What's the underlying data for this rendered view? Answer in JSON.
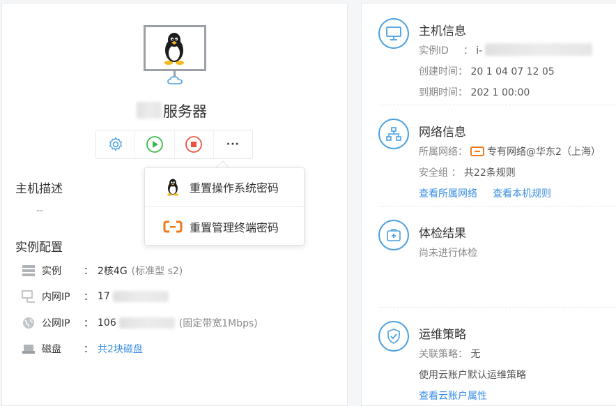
{
  "left": {
    "server_title": "服务器",
    "actions": {
      "more": "···"
    },
    "menu": {
      "reset_os_password": "重置操作系统密码",
      "reset_terminal_password": "重置管理终端密码"
    },
    "host_desc": {
      "title": "主机描述",
      "value": "--"
    },
    "instance_config": {
      "title": "实例配置",
      "rows": [
        {
          "label": "实例",
          "colon": "：",
          "value": "2核4G",
          "note": "(标准型 s2)"
        },
        {
          "label": "内网IP",
          "colon": "：",
          "value": "17",
          "note": ""
        },
        {
          "label": "公网IP",
          "colon": "：",
          "value": "106",
          "note": "(固定带宽1Mbps)"
        },
        {
          "label": "磁盘",
          "colon": "：",
          "value": "共2块磁盘",
          "note": ""
        }
      ]
    }
  },
  "right": {
    "host_info": {
      "title": "主机信息",
      "instance_id_label": "实例ID",
      "instance_id_colon": "：",
      "instance_id_value": "i-",
      "created_label": "创建时间：",
      "created_value": "20 1 04 07 12 05",
      "expire_label": "到期时间：",
      "expire_value": "202 1 00:00"
    },
    "network_info": {
      "title": "网络信息",
      "network_label": "所属网络：",
      "network_value": "专有网络@华东2（上海）",
      "security_label": "安全组 ：",
      "security_value": "共22条规则",
      "link_network": "查看所属网络",
      "link_rules": "查看本机规则"
    },
    "health_check": {
      "title": "体检结果",
      "status": "尚未进行体检"
    },
    "ops_policy": {
      "title": "运维策略",
      "policy_label": "关联策略：",
      "policy_value": "无",
      "policy_desc": "使用云账户默认运维策略",
      "link_account": "查看云账户属性"
    }
  },
  "colors": {
    "accent_blue": "#4a9fe0",
    "link_blue": "#3a8ee6",
    "start_green": "#3cb84a",
    "stop_red": "#e8553e",
    "brand_orange": "#f07a1a"
  },
  "icons": [
    "linux-penguin-icon",
    "monitor-icon",
    "cloud-icon",
    "settings-gear-icon",
    "play-icon",
    "stop-icon",
    "more-icon",
    "server-rack-icon",
    "lan-icon",
    "globe-icon",
    "disk-icon",
    "network-topology-icon",
    "health-kit-icon",
    "shield-check-icon",
    "aliyun-logo-icon"
  ]
}
